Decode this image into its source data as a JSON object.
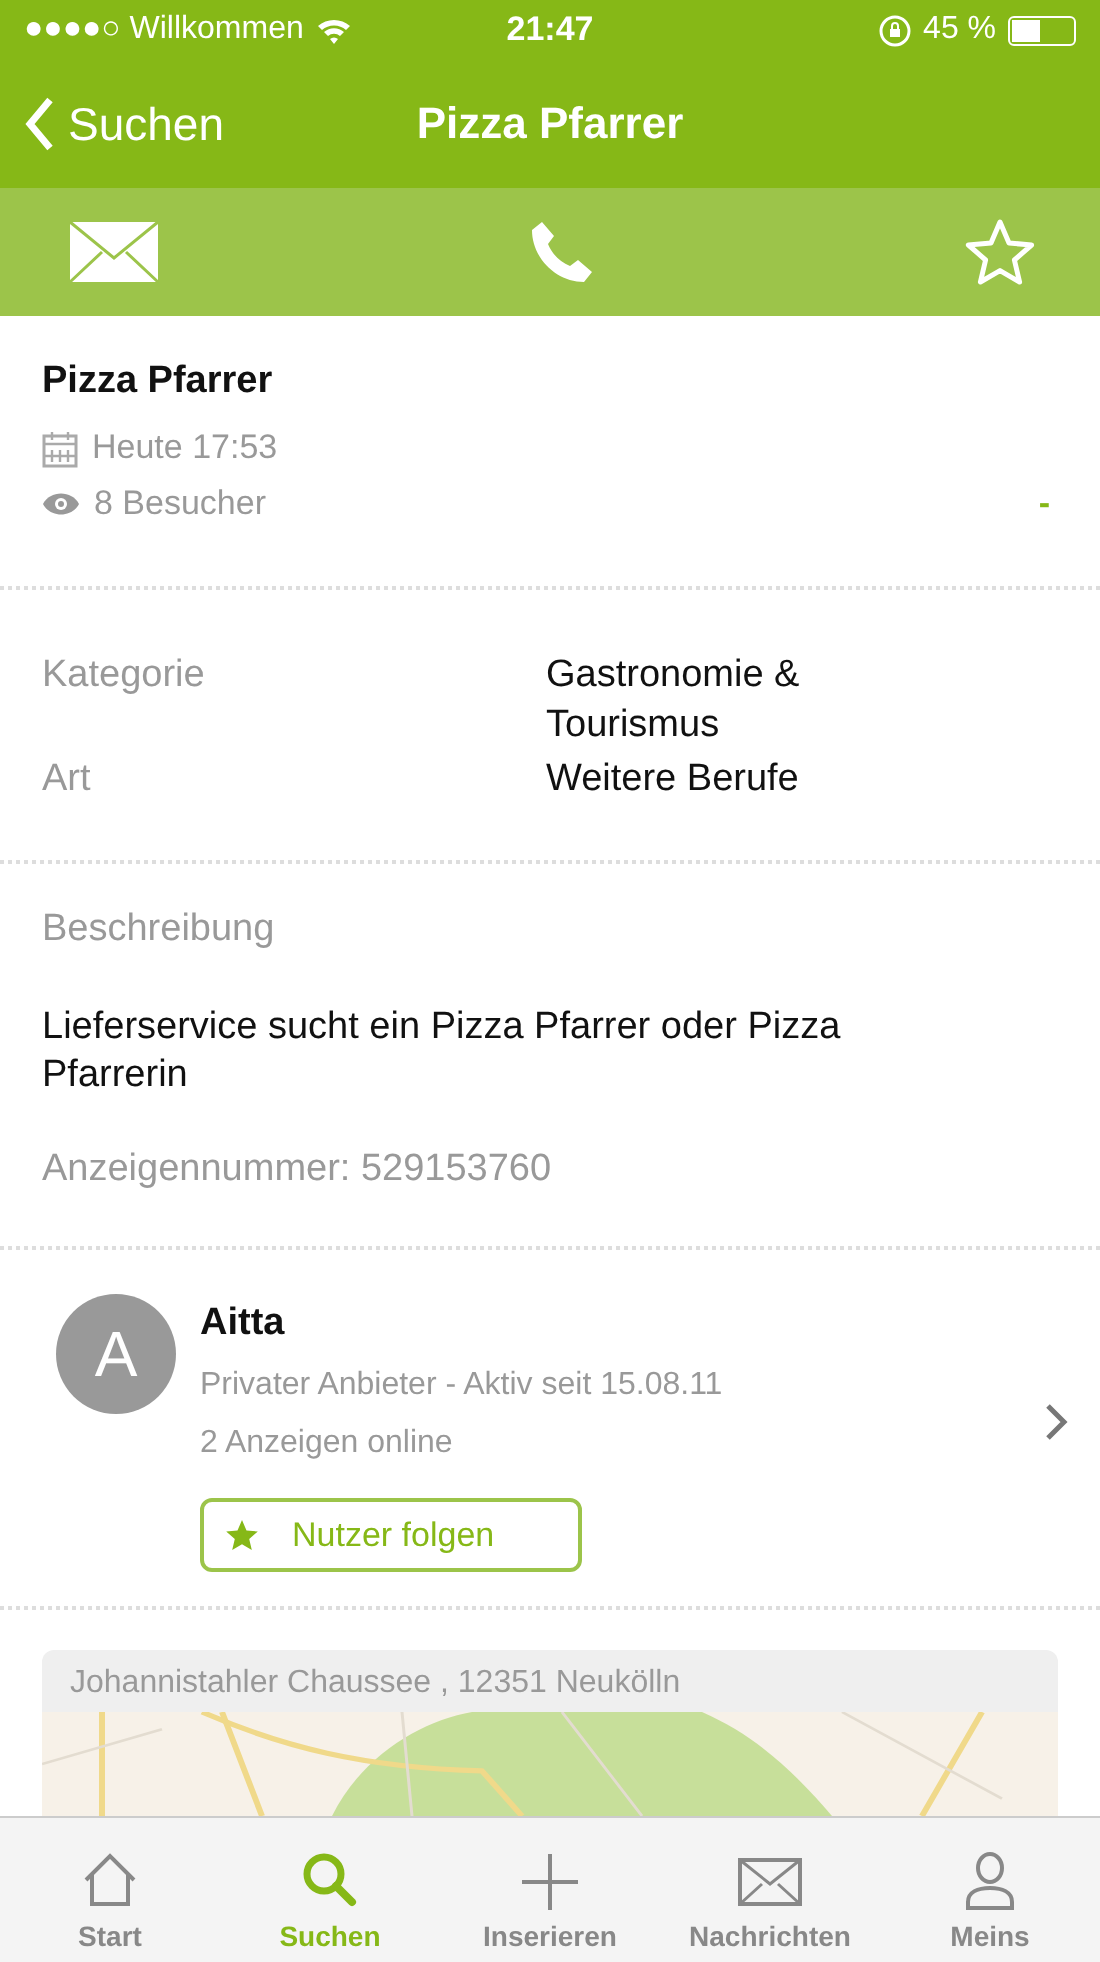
{
  "status_bar": {
    "carrier": "●●●●○ Willkommen",
    "time": "21:47",
    "battery_text": "45 %"
  },
  "nav_bar": {
    "back_label": "Suchen",
    "title": "Pizza Pfarrer"
  },
  "action_bar": {
    "favorite": false
  },
  "listing": {
    "title": "Pizza Pfarrer",
    "date": "Heute 17:53",
    "visitors": "8 Besucher",
    "marker": "-"
  },
  "details": [
    {
      "label": "Kategorie",
      "value": "Gastronomie & Tourismus"
    },
    {
      "label": "Art",
      "value": "Weitere Berufe"
    }
  ],
  "description": {
    "heading": "Beschreibung",
    "text": "Lieferservice sucht ein Pizza Pfarrer oder Pizza Pfarrerin",
    "ad_number": "Anzeigennummer: 529153760"
  },
  "seller": {
    "initial": "A",
    "name": "Aitta",
    "info": "Privater Anbieter - Aktiv seit 15.08.11",
    "ads": "2 Anzeigen online",
    "follow_label": "Nutzer folgen"
  },
  "map": {
    "address": "Johannistahler Chaussee , 12351 Neukölln",
    "kind": "picture"
  },
  "tab_bar": [
    {
      "label": "Start",
      "selected": false
    },
    {
      "label": "Suchen",
      "selected": true
    },
    {
      "label": "Inserieren",
      "selected": false
    },
    {
      "label": "Nachrichten",
      "selected": false
    },
    {
      "label": "Meins",
      "selected": false
    }
  ]
}
